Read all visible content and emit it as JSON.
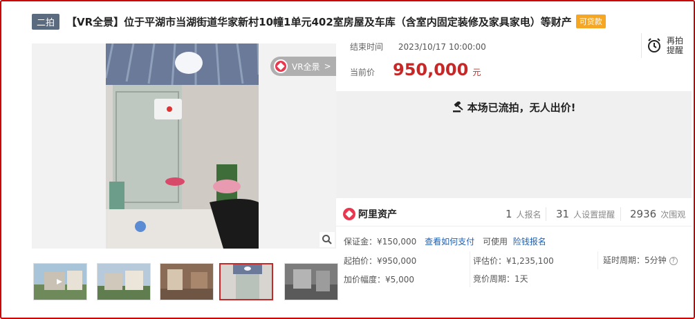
{
  "header": {
    "round_badge": "二拍",
    "title": "【VR全景】位于平湖市当湖街道华家新村10幢1单元402室房屋及车库（含室内固定装修及家具家电）等财产",
    "loan_badge": "可贷款"
  },
  "gallery": {
    "vr_label": "VR全景",
    "vr_arrow": ">",
    "thumbnail_count": 5,
    "active_thumbnail": 4
  },
  "auction": {
    "end_time_label": "结束时间",
    "end_time_value": "2023/10/17 10:00:00",
    "current_price_label": "当前价",
    "current_price_value": "950,000",
    "price_unit": "元",
    "remind_label": "再拍提醒",
    "status_text": "本场已流拍，无人出价!"
  },
  "stats": {
    "brand": "阿里资产",
    "registrations_count": "1",
    "registrations_label": "人报名",
    "reminders_count": "31",
    "reminders_label": "人设置提醒",
    "views_count": "2936",
    "views_label": "次围观"
  },
  "details": {
    "deposit": "保证金：¥150,000",
    "how_to_pay_link": "查看如何支付",
    "can_use_text": "可使用",
    "can_use_link": "险钱报名",
    "starting_price": "起拍价：¥950,000",
    "appraisal_price": "评估价：¥1,235,100",
    "delay_period": "延时周期：5分钟",
    "increment": "加价幅度：¥5,000",
    "bidding_cycle": "竞价周期：1天"
  },
  "colors": {
    "price_red": "#c62828",
    "link_blue": "#1e5fb3",
    "badge_grey": "#5a6b80",
    "loan_orange": "#f5a623",
    "brand_red": "#e8374f"
  }
}
